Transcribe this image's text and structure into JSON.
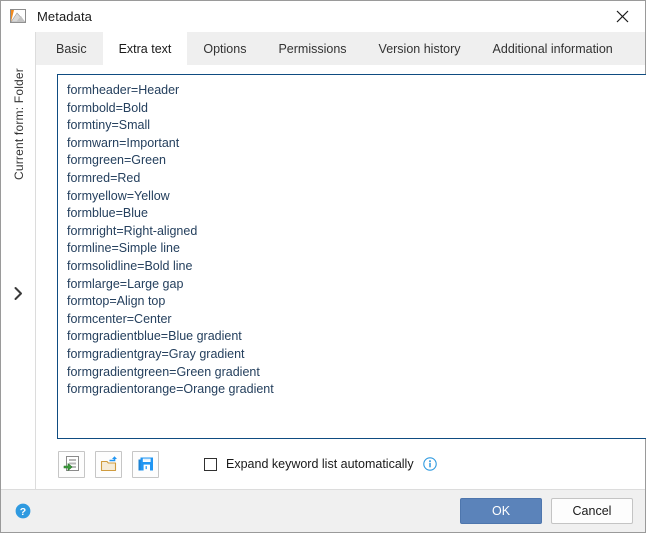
{
  "window": {
    "title": "Metadata",
    "icon": "image-thumbnail-icon",
    "close_label": "✕"
  },
  "sidebar": {
    "current_form_label": "Current form: Folder",
    "expand_icon": "chevron-right-icon"
  },
  "tabs": [
    {
      "label": "Basic",
      "selected": false
    },
    {
      "label": "Extra text",
      "selected": true
    },
    {
      "label": "Options",
      "selected": false
    },
    {
      "label": "Permissions",
      "selected": false
    },
    {
      "label": "Version history",
      "selected": false
    },
    {
      "label": "Additional information",
      "selected": false
    }
  ],
  "extra_text": {
    "value": "formheader=Header\nformbold=Bold\nformtiny=Small\nformwarn=Important\nformgreen=Green\nformred=Red\nformyellow=Yellow\nformblue=Blue\nformright=Right-aligned\nformline=Simple line\nformsolidline=Bold line\nformlarge=Large gap\nformtop=Align top\nformcenter=Center\nformgradientblue=Blue gradient\nformgradientgray=Gray gradient\nformgradientgreen=Green gradient\nformgradientorange=Orange gradient\n",
    "placeholder": "",
    "border_color": "#0f4c81",
    "text_color": "#25405e"
  },
  "toolbar": {
    "buttons": [
      {
        "name": "insert-keyword-icon",
        "title": "Insert"
      },
      {
        "name": "open-folder-icon",
        "title": "Open"
      },
      {
        "name": "save-disk-icon",
        "title": "Save"
      }
    ]
  },
  "options": {
    "expand_keyword_label": "Expand keyword list automatically",
    "expand_keyword_checked": false,
    "info_icon": "info-circle-icon"
  },
  "footer": {
    "help_icon": "help-circle-icon",
    "ok_label": "OK",
    "cancel_label": "Cancel"
  },
  "colors": {
    "accent": "#5b83ba",
    "focus_border": "#0f4c81",
    "tabstrip_bg": "#efefef",
    "footer_bg": "#f0f0f0",
    "info_blue": "#2f9ae0",
    "save_blue": "#2196f3",
    "folder_tan": "#d8a657",
    "arrow_green": "#3b9c3b"
  }
}
